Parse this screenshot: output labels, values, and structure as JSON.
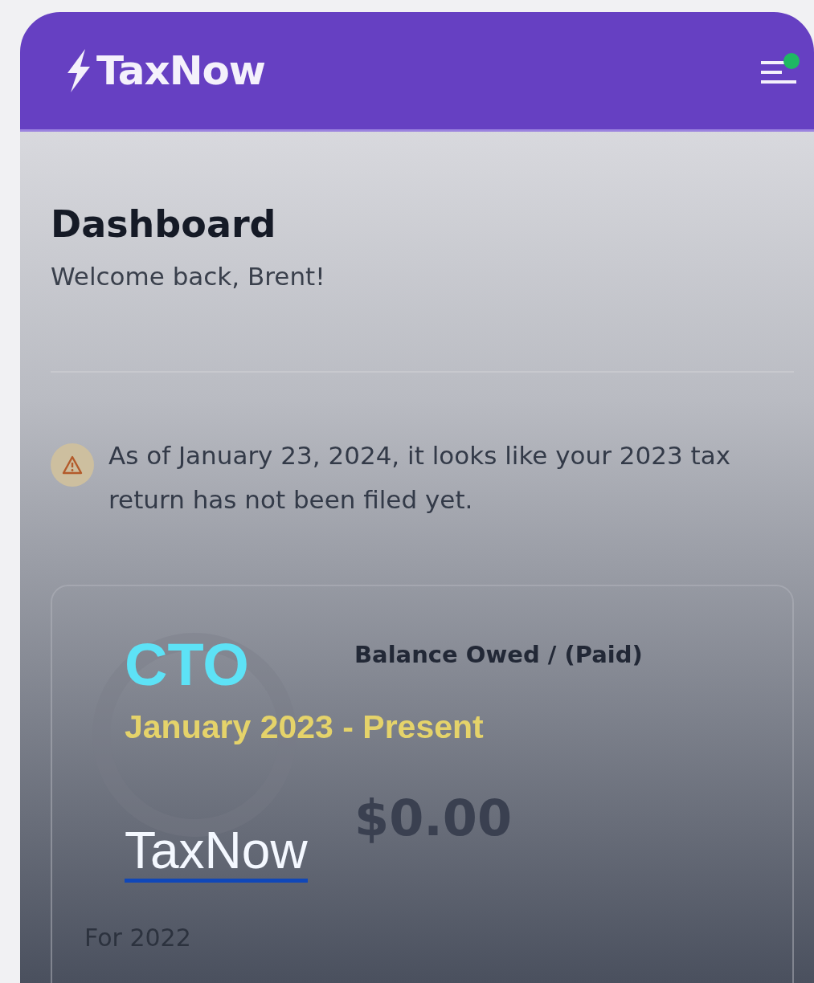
{
  "header": {
    "logo": "TaxNow",
    "notification_dot": true
  },
  "page": {
    "title": "Dashboard",
    "subtitle": "Welcome back, Brent!"
  },
  "alert": {
    "text": "As of January 23, 2024, it looks like your 2023 tax return has not been filed yet."
  },
  "card": {
    "balance_label": "Balance Owed / (Paid)",
    "amount": "$0.00",
    "next_year": "For 2022"
  },
  "overlay": {
    "role": "CTO",
    "period": "January 2023 - Present",
    "company_link": "TaxNow"
  }
}
